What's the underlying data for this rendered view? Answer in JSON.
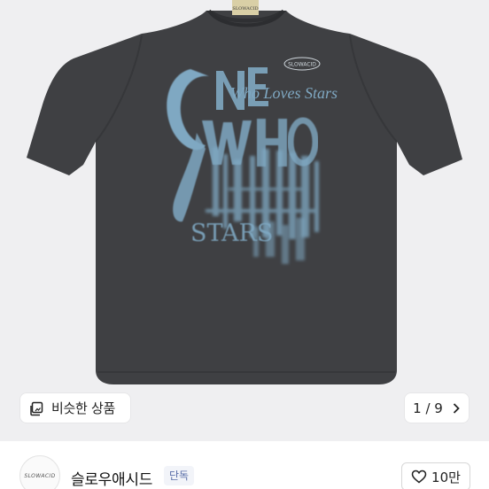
{
  "product": {
    "image": {
      "collar_label": "SLOWACID",
      "patch_label": "SLOWACID",
      "print_words": [
        "ONE",
        "Who Loves Stars",
        "WHO",
        "LOVES",
        "STARS"
      ],
      "shirt_color": "#3f4043",
      "print_color": "#7fa8c2"
    },
    "similar_button": {
      "label": "비슷한 상품",
      "icon": "similar-products-icon"
    },
    "pager": {
      "text": "1 / 9",
      "current": 1,
      "total": 9,
      "icon": "chevron-right-icon"
    }
  },
  "store": {
    "logo_text": "SLOWACID",
    "name": "슬로우애시드",
    "badge": "단독",
    "like": {
      "label": "10만",
      "icon": "heart-outline-icon"
    }
  }
}
